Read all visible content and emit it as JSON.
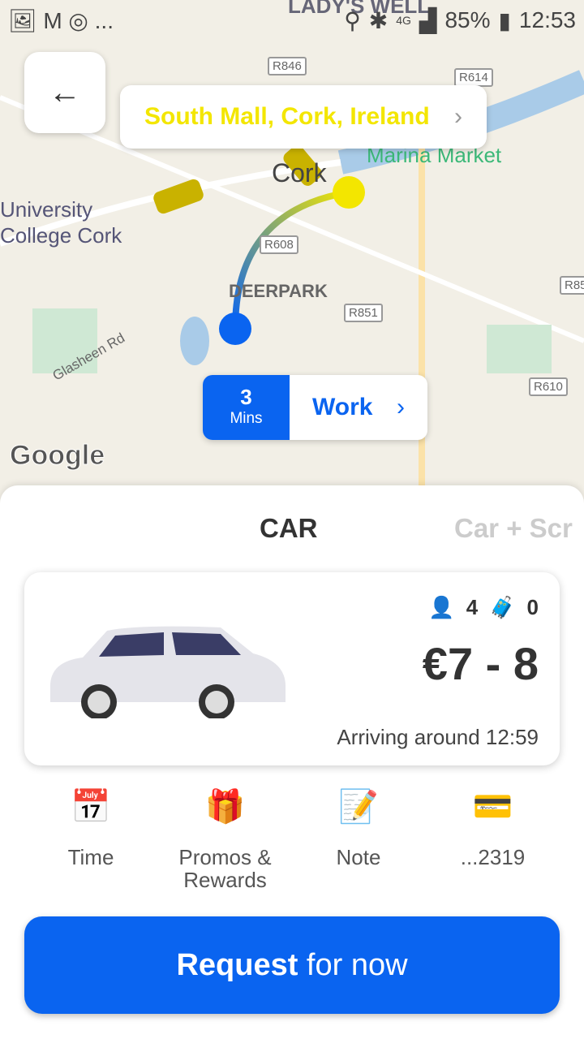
{
  "status": {
    "time": "12:53",
    "battery": "85%",
    "network": "4G",
    "more": "..."
  },
  "map": {
    "labels": [
      "LADY'S WELL",
      "University College Cork",
      "Marina Market",
      "Cork",
      "DEERPARK",
      "Glasheen Rd"
    ],
    "roads": [
      "R846",
      "R614",
      "R608",
      "R851",
      "R610",
      "R85"
    ],
    "google": "Google"
  },
  "destination": "South Mall, Cork, Ireland",
  "eta": {
    "value": "3",
    "unit": "Mins",
    "place": "Work"
  },
  "tabs": [
    "CAR",
    "Car + Scr"
  ],
  "card": {
    "passengers": "4",
    "luggage": "0",
    "price": "€7 - 8",
    "arriving": "Arriving around 12:59"
  },
  "options": [
    {
      "label": "Time",
      "icon": "calendar-clock-icon"
    },
    {
      "label": "Promos & Rewards",
      "icon": "gift-icon"
    },
    {
      "label": "Note",
      "icon": "note-icon"
    },
    {
      "label": "...2319",
      "icon": "mastercard-icon"
    }
  ],
  "request": {
    "bold": "Request",
    "rest": " for now"
  },
  "colors": {
    "accent": "#0a64f0",
    "destination": "#f3e600"
  }
}
